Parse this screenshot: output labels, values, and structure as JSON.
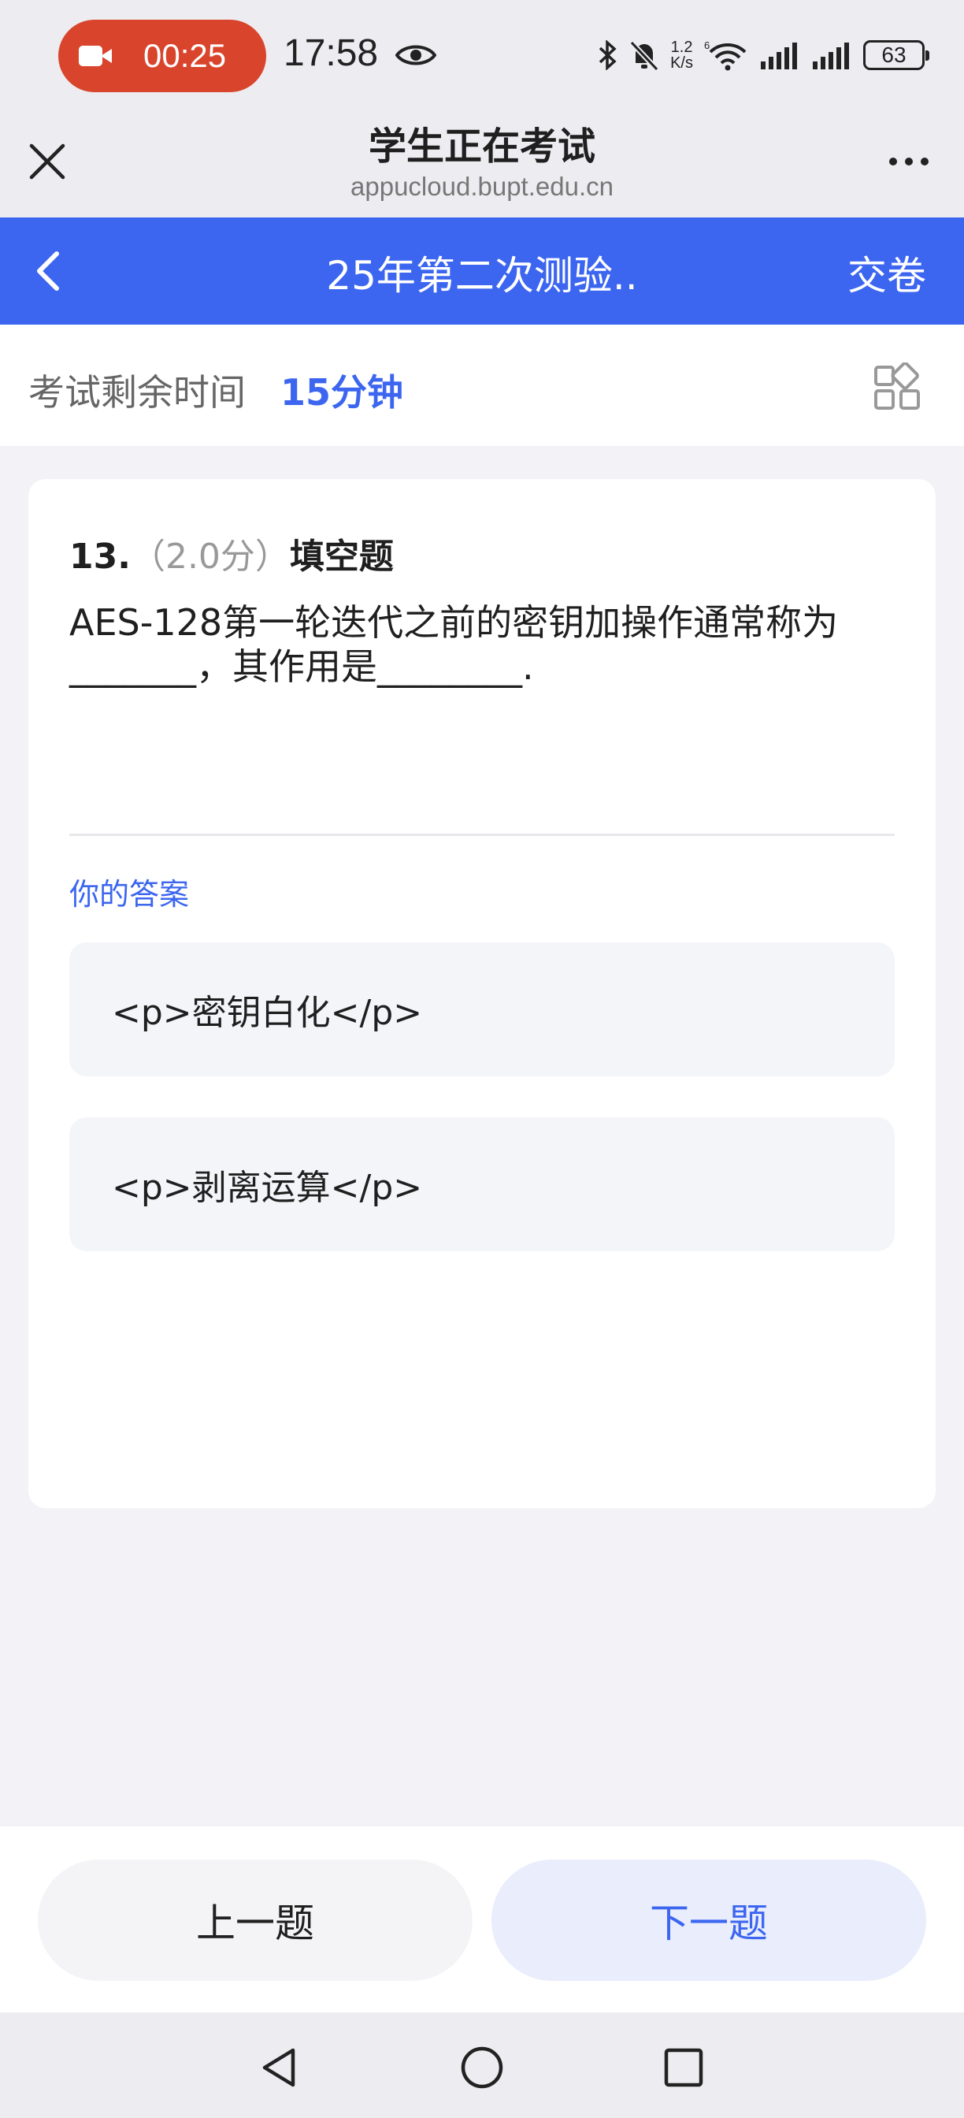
{
  "status_bar": {
    "recording_time": "00:25",
    "clock": "17:58",
    "net_speed_top": "1.2",
    "net_speed_bottom": "K/s",
    "battery": "63"
  },
  "browser": {
    "title": "学生正在考试",
    "url": "appucloud.bupt.edu.cn"
  },
  "app_bar": {
    "title": "25年第二次测验..",
    "submit_label": "交卷"
  },
  "timer": {
    "label": "考试剩余时间",
    "value": "15分钟"
  },
  "question": {
    "number": "13.",
    "score": "（2.0分）",
    "type": "填空题",
    "text_line1": "AES-128第一轮迭代之前的密钥加操作通常称为",
    "text_line2": "_______，其作用是________."
  },
  "answers": {
    "label": "你的答案",
    "items": [
      "<p>密钥白化</p>",
      "<p>剥离运算</p>"
    ]
  },
  "footer": {
    "prev_label": "上一题",
    "next_label": "下一题"
  },
  "colors": {
    "accent": "#3c66f0",
    "record": "#d9442c"
  }
}
